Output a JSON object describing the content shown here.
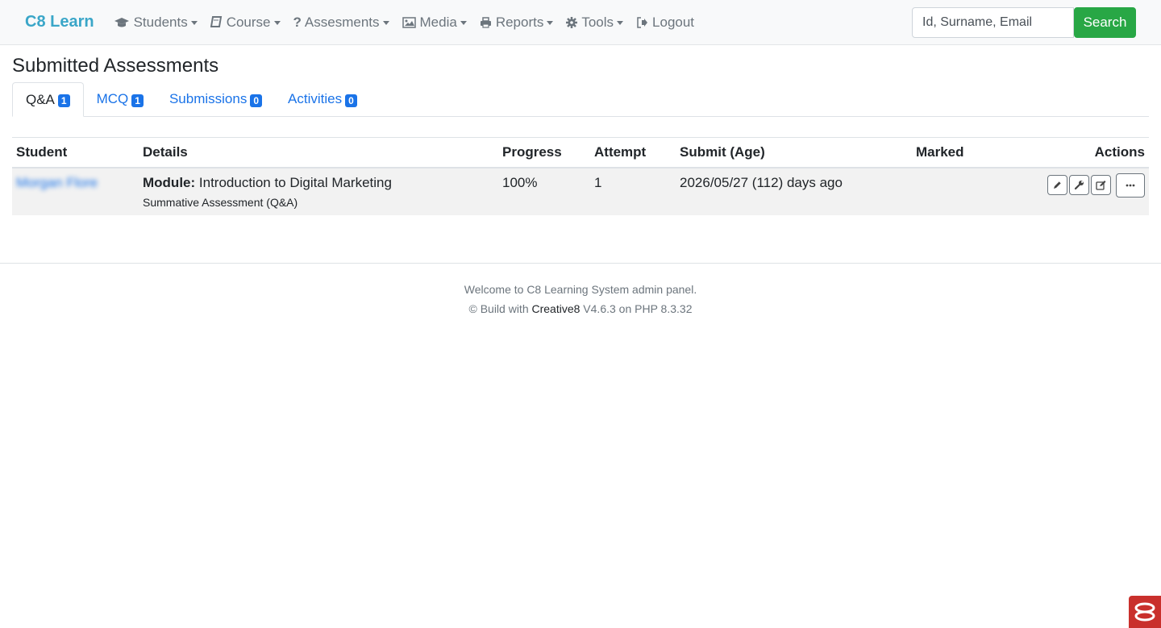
{
  "navbar": {
    "brand": "C8 Learn",
    "items": [
      {
        "label": "Students",
        "icon": "graduation-cap-icon"
      },
      {
        "label": "Course",
        "icon": "book-icon"
      },
      {
        "label": "Assesments",
        "icon": "question-icon"
      },
      {
        "label": "Media",
        "icon": "image-icon"
      },
      {
        "label": "Reports",
        "icon": "print-icon"
      },
      {
        "label": "Tools",
        "icon": "gear-icon"
      },
      {
        "label": "Logout",
        "icon": "sign-out-icon"
      }
    ],
    "search_placeholder": "Id, Surname, Email",
    "search_button": "Search"
  },
  "page": {
    "title": "Submitted Assessments",
    "tabs": [
      {
        "label": "Q&A",
        "count": "1",
        "active": true
      },
      {
        "label": "MCQ",
        "count": "1"
      },
      {
        "label": "Submissions",
        "count": "0"
      },
      {
        "label": "Activities",
        "count": "0"
      }
    ]
  },
  "table": {
    "headers": {
      "student": "Student",
      "details": "Details",
      "progress": "Progress",
      "attempt": "Attempt",
      "submit": "Submit (Age)",
      "marked": "Marked",
      "actions": "Actions"
    },
    "rows": [
      {
        "student": "Morgan Flore",
        "module_label": "Module:",
        "module_name": "Introduction to Digital Marketing",
        "assessment": "Summative Assessment (Q&A)",
        "progress": "100%",
        "attempt": "1",
        "submit": "2026/05/27 (112) days ago",
        "marked": ""
      }
    ]
  },
  "footer": {
    "line1": "Welcome to C8 Learning System admin panel.",
    "line2_prefix": "© Build with ",
    "line2_brand": "Creative8",
    "line2_suffix": " V4.6.3 on PHP 8.3.32"
  },
  "colors": {
    "brand": "#3aa6c8",
    "link": "#1a73e8",
    "search_button": "#28a745",
    "corner_logo": "#c9302c"
  }
}
